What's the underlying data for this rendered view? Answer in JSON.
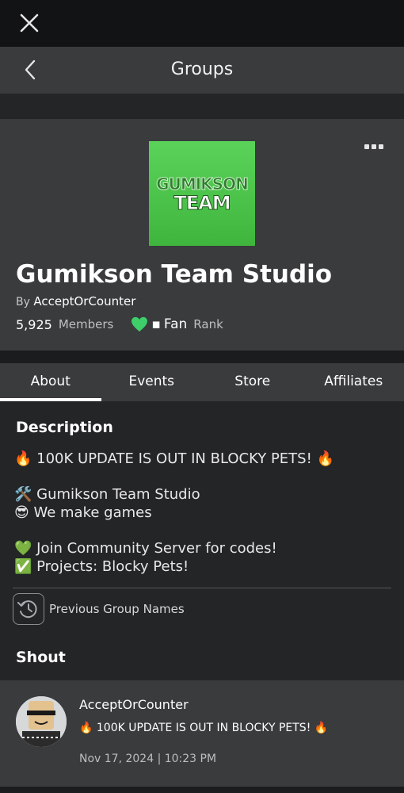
{
  "nav": {
    "title": "Groups",
    "close_icon": "close-icon",
    "back_icon": "chevron-left-icon"
  },
  "group": {
    "logo_text_top": "GUMIKSON",
    "logo_text_bottom": "TEAM",
    "name": "Gumikson Team Studio",
    "by_prefix": "By",
    "owner": "AcceptOrCounter",
    "members_count": "5,925",
    "members_label": "Members",
    "rank_prefix": "▪",
    "rank_name": "Fan",
    "rank_label": "Rank"
  },
  "tabs": [
    {
      "label": "About",
      "active": true
    },
    {
      "label": "Events",
      "active": false
    },
    {
      "label": "Store",
      "active": false
    },
    {
      "label": "Affiliates",
      "active": false
    }
  ],
  "description": {
    "heading": "Description",
    "lines": [
      "🔥 100K UPDATE IS OUT IN BLOCKY PETS! 🔥",
      "🛠️ Gumikson Team Studio",
      "😎 We make games",
      "💚 Join Community Server for codes!",
      "✅ Projects: Blocky Pets!"
    ],
    "prev_names_label": "Previous Group Names"
  },
  "shout": {
    "heading": "Shout",
    "user": "AcceptOrCounter",
    "text": "🔥 100K UPDATE IS OUT IN BLOCKY PETS! 🔥",
    "date": "Nov 17, 2024 | 10:23 PM"
  },
  "colors": {
    "logo_green": "#4cc24a",
    "heart_green": "#3ecf6a",
    "panel": "#393b3d",
    "background": "#232527"
  }
}
